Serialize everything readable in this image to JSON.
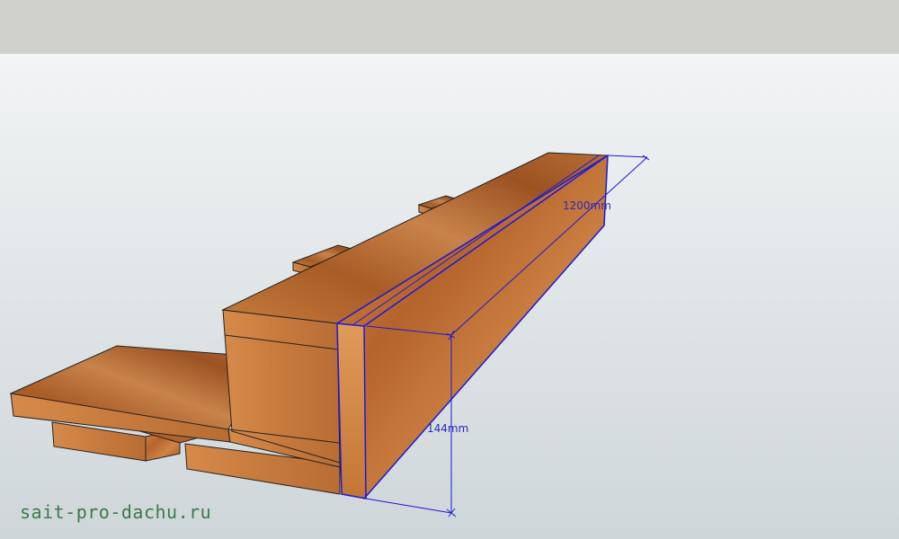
{
  "viewport": {
    "dimension_length": "1200mm",
    "dimension_height": "144mm"
  },
  "watermark": {
    "text": "sait-pro-dachu.ru"
  },
  "colors": {
    "toolbar_strip": "#d0d0cd",
    "wood_light": "#c9783a",
    "wood_dark": "#a65a26",
    "selection_edge": "#1a1ad8",
    "dimension_text": "#2b2bb5",
    "watermark": "#3c7a4a"
  }
}
